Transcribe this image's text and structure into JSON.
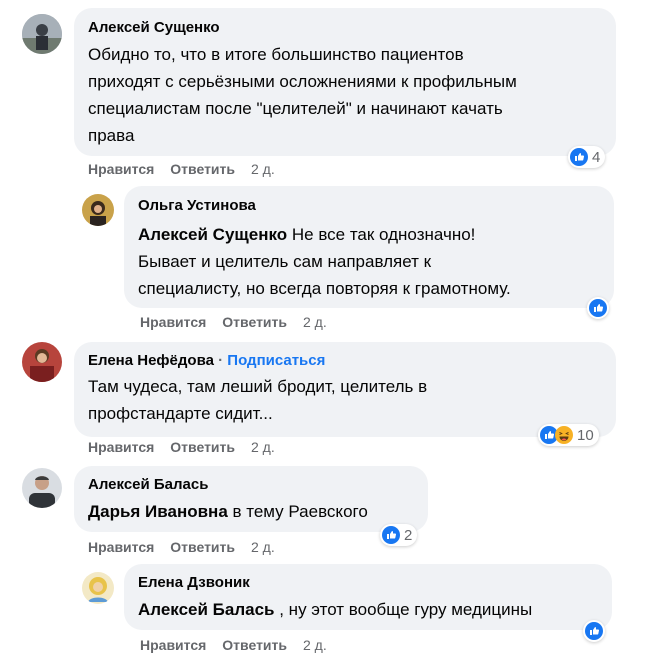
{
  "comments": [
    {
      "author": "Алексей Сущенко",
      "lines": [
        "Обидно то, что в итоге большинство пациентов",
        "приходят с серьёзными осложнениями к профильным",
        "специалистам после \"целителей\" и начинают качать",
        "права"
      ],
      "like": "Нравится",
      "reply": "Ответить",
      "time": "2 д.",
      "reactions": "4"
    },
    {
      "author": "Ольга Устинова",
      "mention": "Алексей Сущенко",
      "lines": [
        " Не все так однозначно!",
        "Бывает и целитель сам направляет к",
        "специалисту, но всегда повторяя к грамотному."
      ],
      "like": "Нравится",
      "reply": "Ответить",
      "time": "2 д."
    },
    {
      "author": "Елена Нефёдова",
      "separator": "·",
      "follow": "Подписаться",
      "lines": [
        "Там чудеса, там леший бродит, целитель в",
        "профстандарте сидит..."
      ],
      "like": "Нравится",
      "reply": "Ответить",
      "time": "2 д.",
      "reactions": "10"
    },
    {
      "author": "Алексей Балась",
      "mention": "Дарья Ивановна",
      "lines": [
        " в тему Раевского"
      ],
      "like": "Нравится",
      "reply": "Ответить",
      "time": "2 д.",
      "reactions": "2"
    },
    {
      "author": "Елена Дзвоник",
      "mention": "Алексей Балась",
      "lines": [
        " , ну этот вообще гуру медицины"
      ],
      "like": "Нравится",
      "reply": "Ответить",
      "time": "2 д."
    }
  ],
  "colors": {
    "bubble": "#f0f2f5",
    "link": "#1877f2",
    "meta": "#65676b",
    "like": "#1877f2",
    "haha": "#f7b125"
  }
}
